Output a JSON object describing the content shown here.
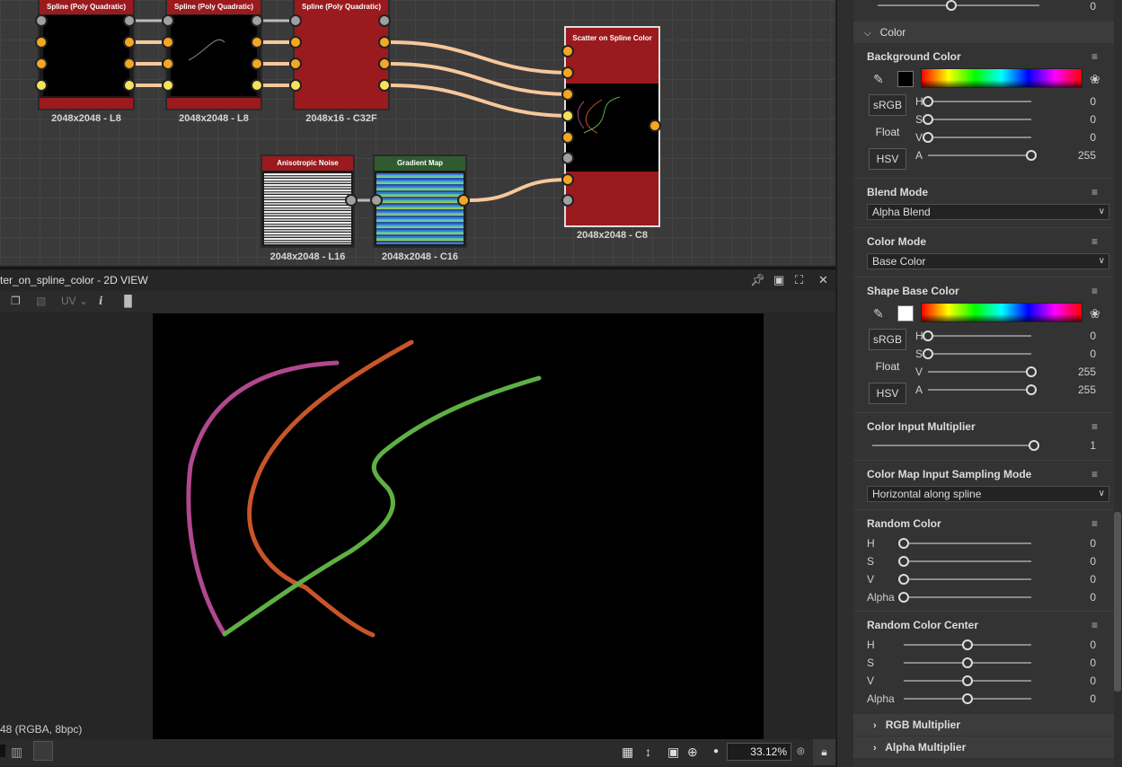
{
  "graph": {
    "nodes": [
      {
        "title": "Spline (Poly Quadratic)",
        "label": "2048x2048 - L8"
      },
      {
        "title": "Spline (Poly Quadratic)",
        "label": "2048x2048 - L8"
      },
      {
        "title": "Spline (Poly Quadratic)",
        "label": "2048x16 - C32F"
      },
      {
        "title": "Scatter on Spline Color",
        "label": "2048x2048 - C8"
      },
      {
        "title": "Anisotropic Noise",
        "label": "2048x2048 - L16"
      },
      {
        "title": "Gradient Map",
        "label": "2048x2048 - C16"
      }
    ]
  },
  "view": {
    "title": "ter_on_spline_color - 2D VIEW",
    "uv_label": "UV",
    "info": "48 (RGBA, 8bpc)",
    "zoom": "33.12%"
  },
  "panel": {
    "top_slider_value": "0",
    "section_title": "Color",
    "background_color": {
      "label": "Background Color",
      "swatch": "#000000",
      "srgb": "sRGB",
      "float": "Float",
      "hsv": "HSV",
      "rows": [
        {
          "k": "H",
          "v": "0",
          "level": 0
        },
        {
          "k": "S",
          "v": "0",
          "level": 0
        },
        {
          "k": "V",
          "v": "0",
          "level": 0
        },
        {
          "k": "A",
          "v": "255",
          "level": 1
        }
      ]
    },
    "blend_mode": {
      "label": "Blend Mode",
      "value": "Alpha Blend"
    },
    "color_mode": {
      "label": "Color Mode",
      "value": "Base Color"
    },
    "shape_base_color": {
      "label": "Shape Base Color",
      "swatch": "#ffffff",
      "srgb": "sRGB",
      "float": "Float",
      "hsv": "HSV",
      "rows": [
        {
          "k": "H",
          "v": "0",
          "level": 0
        },
        {
          "k": "S",
          "v": "0",
          "level": 0
        },
        {
          "k": "V",
          "v": "255",
          "level": 1
        },
        {
          "k": "A",
          "v": "255",
          "level": 1
        }
      ]
    },
    "color_input_multiplier": {
      "label": "Color Input Multiplier",
      "value": "1",
      "level": 1
    },
    "color_map_sampling": {
      "label": "Color Map Input Sampling Mode",
      "value": "Horizontal along spline"
    },
    "random_color": {
      "label": "Random Color",
      "rows": [
        {
          "k": "H",
          "v": "0",
          "level": 0
        },
        {
          "k": "S",
          "v": "0",
          "level": 0
        },
        {
          "k": "V",
          "v": "0",
          "level": 0
        },
        {
          "k": "Alpha",
          "v": "0",
          "level": 0
        }
      ]
    },
    "random_color_center": {
      "label": "Random Color Center",
      "rows": [
        {
          "k": "H",
          "v": "0",
          "level": 0.5
        },
        {
          "k": "S",
          "v": "0",
          "level": 0.5
        },
        {
          "k": "V",
          "v": "0",
          "level": 0.5
        },
        {
          "k": "Alpha",
          "v": "0",
          "level": 0.5
        }
      ]
    },
    "rgb_multiplier": "RGB Multiplier",
    "alpha_multiplier": "Alpha Multiplier"
  },
  "colors": {
    "accent_red": "#9a1a1e",
    "port_orange": "#f5a623",
    "port_yellow": "#f4e25a",
    "spline_purple": "#b0488f",
    "spline_orange": "#c8552a",
    "spline_green": "#5fb043"
  }
}
